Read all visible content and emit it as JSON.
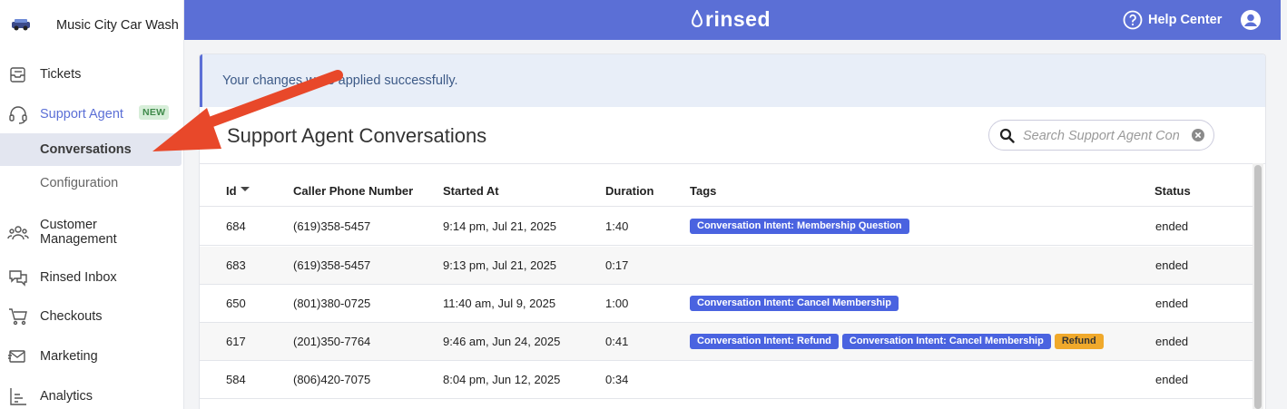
{
  "brand": {
    "name": "Music City Car Wash"
  },
  "topbar": {
    "logo": "rinsed",
    "help_label": "Help Center"
  },
  "sidebar": {
    "items": [
      {
        "label": "Tickets",
        "icon": "ticket-icon"
      },
      {
        "label": "Support Agent",
        "icon": "headset-icon",
        "badge": "NEW"
      },
      {
        "label": "Customer\nManagement",
        "icon": "users-icon"
      },
      {
        "label": "Rinsed Inbox",
        "icon": "chat-icon"
      },
      {
        "label": "Checkouts",
        "icon": "cart-icon"
      },
      {
        "label": "Marketing",
        "icon": "mail-icon"
      },
      {
        "label": "Analytics",
        "icon": "chart-icon"
      }
    ],
    "subitems": [
      {
        "label": "Conversations",
        "active": true
      },
      {
        "label": "Configuration",
        "active": false
      }
    ]
  },
  "alert": {
    "message": "Your changes were applied successfully."
  },
  "page": {
    "title": "Support Agent Conversations",
    "search_placeholder": "Search Support Agent Conversations"
  },
  "table": {
    "columns": [
      "Id",
      "Caller Phone Number",
      "Started At",
      "Duration",
      "Tags",
      "Status"
    ],
    "rows": [
      {
        "id": "684",
        "phone": "(619)358-5457",
        "started": "9:14 pm, Jul 21, 2025",
        "duration": "1:40",
        "tags": [
          "Conversation Intent: Membership Question"
        ],
        "status": "ended"
      },
      {
        "id": "683",
        "phone": "(619)358-5457",
        "started": "9:13 pm, Jul 21, 2025",
        "duration": "0:17",
        "tags": [],
        "status": "ended"
      },
      {
        "id": "650",
        "phone": "(801)380-0725",
        "started": "11:40 am, Jul 9, 2025",
        "duration": "1:00",
        "tags": [
          "Conversation Intent: Cancel Membership"
        ],
        "status": "ended"
      },
      {
        "id": "617",
        "phone": "(201)350-7764",
        "started": "9:46 am, Jun 24, 2025",
        "duration": "0:41",
        "tags": [
          "Conversation Intent: Refund",
          "Conversation Intent: Cancel Membership",
          "Refund"
        ],
        "status": "ended"
      },
      {
        "id": "584",
        "phone": "(806)420-7075",
        "started": "8:04 pm, Jun 12, 2025",
        "duration": "0:34",
        "tags": [],
        "status": "ended"
      }
    ]
  },
  "colors": {
    "accent": "#5b6fd6",
    "tag": "#4a63e0",
    "tag_refund": "#f0a92b",
    "arrow": "#e8482a"
  }
}
